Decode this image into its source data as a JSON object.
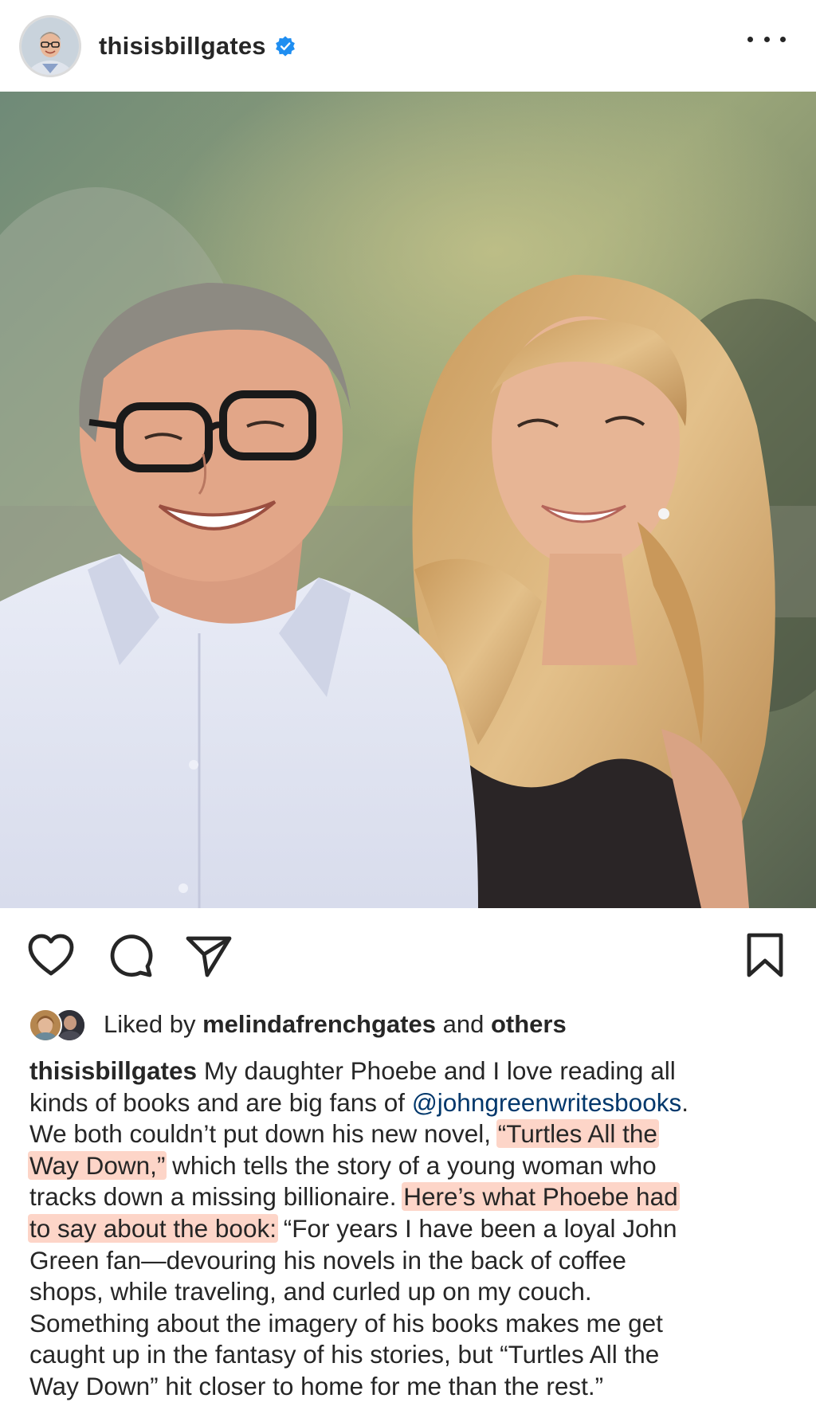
{
  "header": {
    "username": "thisisbillgates",
    "verified_icon": "verified-badge-icon",
    "more_icon": "more-options-icon"
  },
  "photo": {
    "description_icon": "post-photo"
  },
  "actions": {
    "like_icon": "heart-icon",
    "comment_icon": "comment-icon",
    "share_icon": "send-icon",
    "save_icon": "bookmark-icon"
  },
  "likes": {
    "prefix": "Liked by",
    "user": "melindafrenchgates",
    "conjunction": "and",
    "others": "others"
  },
  "caption": {
    "username": "thisisbillgates",
    "line1_rest": " My daughter Phoebe and I love reading all",
    "line2_a": "kinds of books and are big fans of ",
    "line2_mention": "@johngreenwritesbooks",
    "line2_b": ".",
    "line3_a": "We both couldn’t put down his new novel, ",
    "line3_hl": "“Turtles All the",
    "line4_hl": "Way Down,”",
    "line4_b": " which tells the story of a young woman who",
    "line5_a": "tracks down a missing billionaire. ",
    "line5_hl": "Here’s what Phoebe had",
    "line6_hl": "to say about the book:",
    "line6_b": " “For years I have been a loyal John",
    "line7": "Green fan—devouring his novels in the back of coffee",
    "line8": "shops, while traveling, and curled up on my couch.",
    "line9": "Something about the imagery of his books makes me get",
    "line10": "caught up in the fantasy of his stories, but “Turtles All the",
    "line11": "Way Down” hit closer to home for me than the rest.”"
  },
  "colors": {
    "text": "#262626",
    "mention": "#00376b",
    "highlight": "#fdd5c8",
    "verified": "#1f8ef1"
  }
}
